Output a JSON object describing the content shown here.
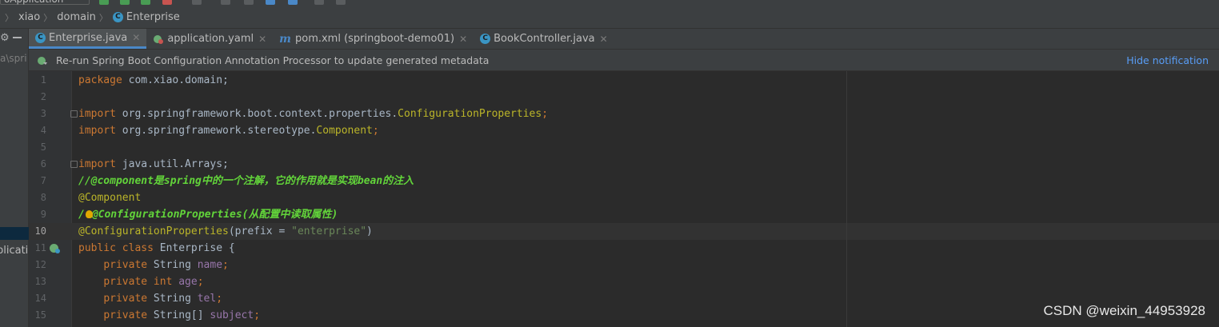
{
  "toolbar": {
    "run_config": "oApplication"
  },
  "breadcrumb": {
    "items": [
      "xiao",
      "domain",
      "Enterprise"
    ]
  },
  "left_panel": {
    "project_path_fragment": "a\\spri",
    "selected_item_fragment": "plicati"
  },
  "tabs": [
    {
      "label": "Enterprise.java",
      "active": true
    },
    {
      "label": "application.yaml",
      "active": false
    },
    {
      "label": "pom.xml (springboot-demo01)",
      "active": false
    },
    {
      "label": "BookController.java",
      "active": false
    }
  ],
  "notification": {
    "message": "Re-run Spring Boot Configuration Annotation Processor to update generated metadata",
    "action": "Hide notification"
  },
  "editor": {
    "current_line": 10,
    "line_numbers": [
      "1",
      "2",
      "3",
      "4",
      "5",
      "6",
      "7",
      "8",
      "9",
      "10",
      "11",
      "12",
      "13",
      "14",
      "15"
    ],
    "lines": {
      "l1_kw": "package",
      "l1_rest": " com.xiao.domain;",
      "l3_kw": "import",
      "l3_pkg": " org.springframework.boot.context.properties.",
      "l3_cls": "ConfigurationProperties",
      "l3_end": ";",
      "l4_kw": "import",
      "l4_pkg": " org.springframework.stereotype.",
      "l4_cls": "Component",
      "l4_end": ";",
      "l6_kw": "import",
      "l6_rest": " java.util.Arrays;",
      "l7_comment": "//@component是spring中的一个注解，它的作用就是实现bean的注入",
      "l8_ann": "@Component",
      "l9_comment_a": "/",
      "l9_comment_b": "@ConfigurationProperties(从配置中读取属性)",
      "l10_ann": "@ConfigurationProperties",
      "l10_open": "(prefix = ",
      "l10_str": "\"enterprise\"",
      "l10_close": ")",
      "l11_kw": "public class",
      "l11_rest": " Enterprise {",
      "l12_kw": "private",
      "l12_type": " String ",
      "l12_fld": "name",
      "l13_kw": "private int",
      "l13_fld": " age",
      "l14_kw": "private",
      "l14_type": " String ",
      "l14_fld": "tel",
      "l15_kw": "private",
      "l15_type": " String[] ",
      "l15_fld": "subject",
      "semi": ";"
    }
  },
  "watermark": "CSDN @weixin_44953928",
  "colors": {
    "keyword": "#cc7832",
    "annotation": "#bbb529",
    "string": "#6a8759",
    "field": "#9876aa",
    "comment": "#62d43a",
    "link": "#589df6",
    "tab_underline": "#4a88c7"
  }
}
